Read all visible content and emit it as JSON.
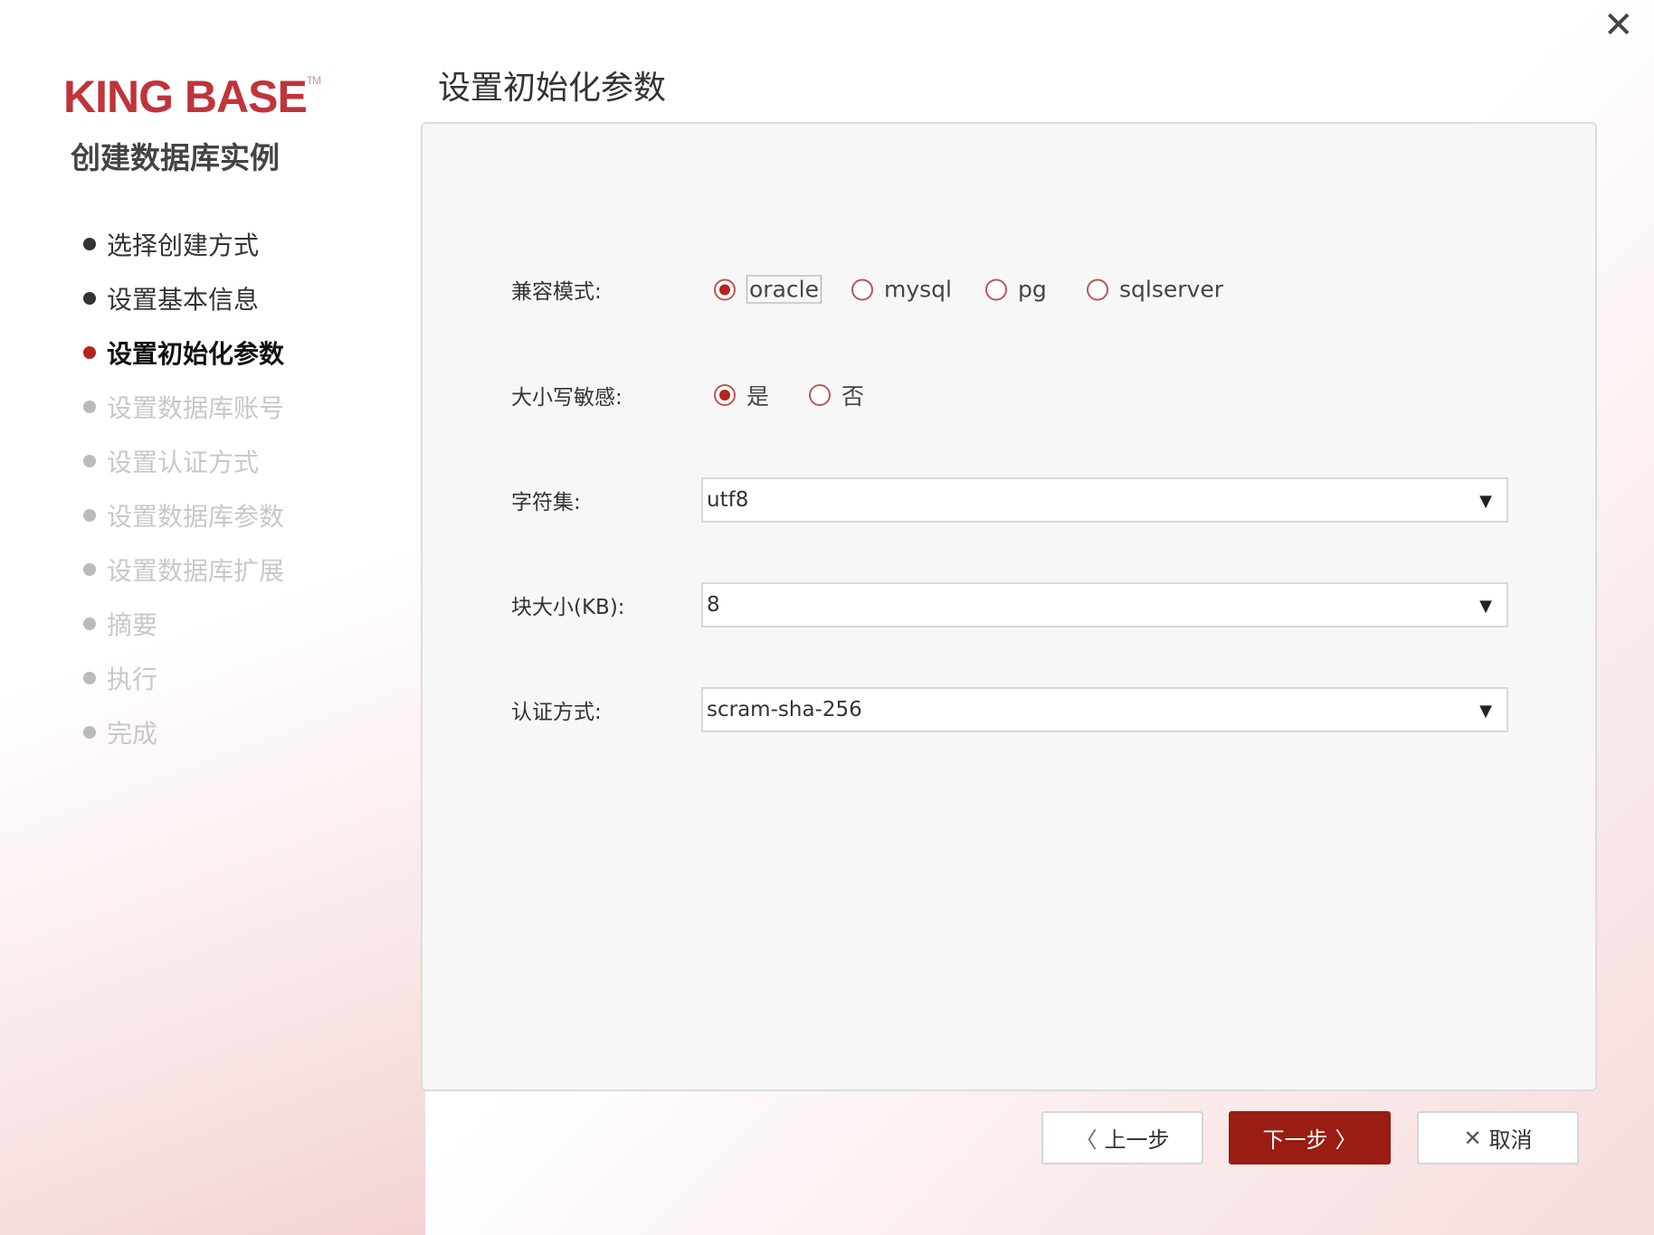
{
  "window": {
    "close_icon": "close-icon"
  },
  "brand": {
    "logo": "KING BASE",
    "tm": "TM",
    "subtitle": "创建数据库实例"
  },
  "steps": [
    {
      "label": "选择创建方式",
      "state": "done"
    },
    {
      "label": "设置基本信息",
      "state": "done"
    },
    {
      "label": "设置初始化参数",
      "state": "active"
    },
    {
      "label": "设置数据库账号",
      "state": "pending"
    },
    {
      "label": "设置认证方式",
      "state": "pending"
    },
    {
      "label": "设置数据库参数",
      "state": "pending"
    },
    {
      "label": "设置数据库扩展",
      "state": "pending"
    },
    {
      "label": "摘要",
      "state": "pending"
    },
    {
      "label": "执行",
      "state": "pending"
    },
    {
      "label": "完成",
      "state": "pending"
    }
  ],
  "page_title": "设置初始化参数",
  "form": {
    "compat_label": "兼容模式:",
    "compat_options": [
      "oracle",
      "mysql",
      "pg",
      "sqlserver"
    ],
    "compat_selected": "oracle",
    "case_label": "大小写敏感:",
    "case_options": [
      "是",
      "否"
    ],
    "case_selected": "是",
    "charset_label": "字符集:",
    "charset_value": "utf8",
    "block_label": "块大小(KB):",
    "block_value": "8",
    "auth_label": "认证方式:",
    "auth_value": "scram-sha-256"
  },
  "buttons": {
    "prev": "上一步",
    "next": "下一步",
    "cancel": "取消"
  },
  "colors": {
    "accent": "#9a1c12",
    "logo": "#c0343a"
  }
}
